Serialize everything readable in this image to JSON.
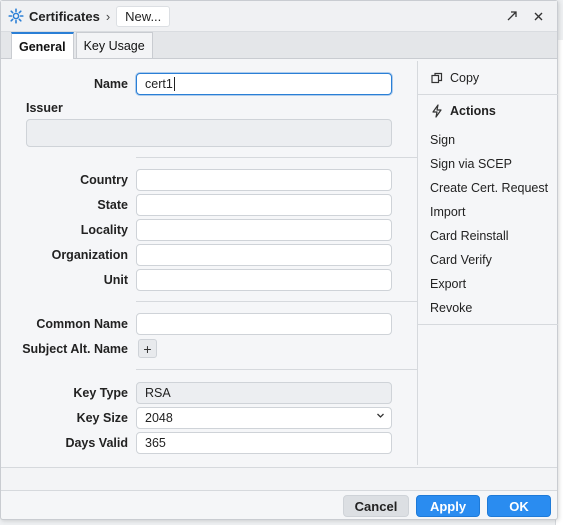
{
  "window": {
    "title": "Certificates",
    "breadcrumb_current": "New..."
  },
  "tabs": [
    {
      "label": "General",
      "active": true
    },
    {
      "label": "Key Usage",
      "active": false
    }
  ],
  "form": {
    "name_label": "Name",
    "name_value": "cert1",
    "issuer_label": "Issuer",
    "issuer_value": "",
    "country_label": "Country",
    "country_value": "",
    "state_label": "State",
    "state_value": "",
    "locality_label": "Locality",
    "locality_value": "",
    "organization_label": "Organization",
    "organization_value": "",
    "unit_label": "Unit",
    "unit_value": "",
    "common_name_label": "Common Name",
    "common_name_value": "",
    "subject_alt_name_label": "Subject Alt. Name",
    "key_type_label": "Key Type",
    "key_type_value": "RSA",
    "key_size_label": "Key Size",
    "key_size_value": "2048",
    "days_valid_label": "Days Valid",
    "days_valid_value": "365"
  },
  "side": {
    "copy_label": "Copy",
    "actions_heading": "Actions",
    "actions": [
      "Sign",
      "Sign via SCEP",
      "Create Cert. Request",
      "Import",
      "Card Reinstall",
      "Card Verify",
      "Export",
      "Revoke"
    ]
  },
  "footer": {
    "cancel_label": "Cancel",
    "apply_label": "Apply",
    "ok_label": "OK"
  },
  "colors": {
    "accent": "#2a8cf0",
    "focus_border": "#2a7fd6"
  }
}
